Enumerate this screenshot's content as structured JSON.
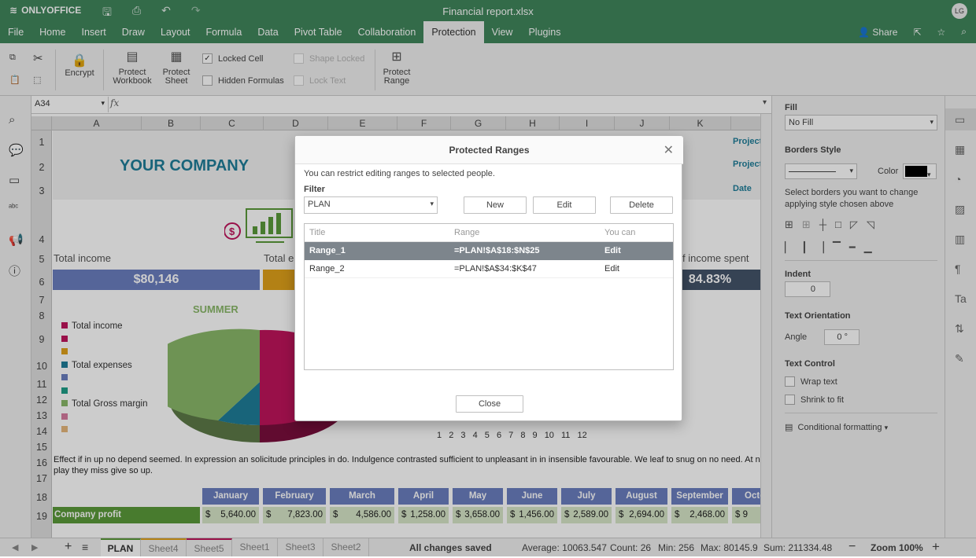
{
  "app": {
    "logo": "ONLYOFFICE",
    "title": "Financial report.xlsx",
    "avatar": "LG"
  },
  "menu": {
    "items": [
      "File",
      "Home",
      "Insert",
      "Draw",
      "Layout",
      "Formula",
      "Data",
      "Pivot Table",
      "Collaboration",
      "Protection",
      "View",
      "Plugins"
    ],
    "active": "Protection",
    "share": "Share"
  },
  "ribbon": {
    "encrypt": "Encrypt",
    "protect_workbook": "Protect Workbook",
    "protect_sheet": "Protect Sheet",
    "locked_cell": "Locked Cell",
    "hidden_formulas": "Hidden Formulas",
    "shape_locked": "Shape Locked",
    "lock_text": "Lock Text",
    "protect_range": "Protect Range"
  },
  "formula_bar": {
    "cell_ref": "A34",
    "fx": "fx",
    "formula": ""
  },
  "columns": [
    "A",
    "B",
    "C",
    "D",
    "E",
    "F",
    "G",
    "H",
    "I",
    "J",
    "K"
  ],
  "rows": [
    "1",
    "2",
    "3",
    "4",
    "5",
    "6",
    "7",
    "8",
    "9",
    "10",
    "11",
    "12",
    "13",
    "14",
    "15",
    "16",
    "17",
    "18",
    "19"
  ],
  "sheet": {
    "company": "YOUR COMPANY",
    "projects": [
      "Project",
      "Project",
      "Date"
    ],
    "total_income_label": "Total income",
    "total_expenses_label": "Total e",
    "income_spent_label": "f income spent",
    "total_income_value": "$80,146",
    "income_spent_value": "84.83%",
    "chart_title": "SUMMER",
    "legend": [
      "Total income",
      "",
      "",
      "Total expenses",
      "",
      "",
      "Total Gross margin",
      "",
      ""
    ],
    "axis_numbers": [
      "1",
      "2",
      "3",
      "4",
      "5",
      "6",
      "7",
      "8",
      "9",
      "10",
      "11",
      "12"
    ],
    "paragraph": "Effect if in up no depend seemed. In expression an solicitude principles in do. Indulgence contrasted sufficient to unpleasant in in insensible favourable. We leaf to snug on no need. At none ne",
    "paragraph2": "play they miss give so up.",
    "months": [
      "January",
      "February",
      "March",
      "April",
      "May",
      "June",
      "July",
      "August",
      "September",
      "Octo"
    ],
    "profit_label": "Company profit",
    "currency": "$",
    "profits": [
      "5,640.00",
      "7,823.00",
      "4,586.00",
      "1,258.00",
      "3,658.00",
      "1,456.00",
      "2,589.00",
      "2,694.00",
      "2,468.00",
      "9"
    ]
  },
  "right_panel": {
    "fill": "Fill",
    "fill_value": "No Fill",
    "borders_style": "Borders Style",
    "color": "Color",
    "borders_help": "Select borders you want to change applying style chosen above",
    "indent": "Indent",
    "indent_value": "0",
    "text_orientation": "Text Orientation",
    "angle": "Angle",
    "angle_value": "0 °",
    "text_control": "Text Control",
    "wrap_text": "Wrap text",
    "shrink_to_fit": "Shrink to fit",
    "conditional_formatting": "Conditional formatting"
  },
  "status": {
    "sheets": [
      "PLAN",
      "Sheet4",
      "Sheet5",
      "Sheet1",
      "Sheet3",
      "Sheet2"
    ],
    "saved": "All changes saved",
    "average": "Average: 10063.547",
    "count": "Count: 26",
    "min": "Min: 256",
    "max": "Max: 80145.9",
    "sum": "Sum: 211334.48",
    "zoom": "Zoom 100%"
  },
  "dialog": {
    "title": "Protected Ranges",
    "description": "You can restrict editing ranges to selected people.",
    "filter_label": "Filter",
    "filter_value": "PLAN",
    "new": "New",
    "edit": "Edit",
    "delete": "Delete",
    "headers": {
      "title": "Title",
      "range": "Range",
      "you_can": "You can"
    },
    "rows": [
      {
        "title": "Range_1",
        "range": "=PLAN!$A$18:$N$25",
        "you_can": "Edit"
      },
      {
        "title": "Range_2",
        "range": "=PLAN!$A$34:$K$47",
        "you_can": "Edit"
      }
    ],
    "close": "Close"
  },
  "colors": {
    "brand": "#40865c",
    "accent": "#5b9a3a",
    "income": "#6b7fc0",
    "expenses": "#e0a21b",
    "spent": "#44546a",
    "pie_green": "#8ab86a",
    "pie_pink": "#c0145c",
    "pie_blue": "#1f7e99"
  }
}
